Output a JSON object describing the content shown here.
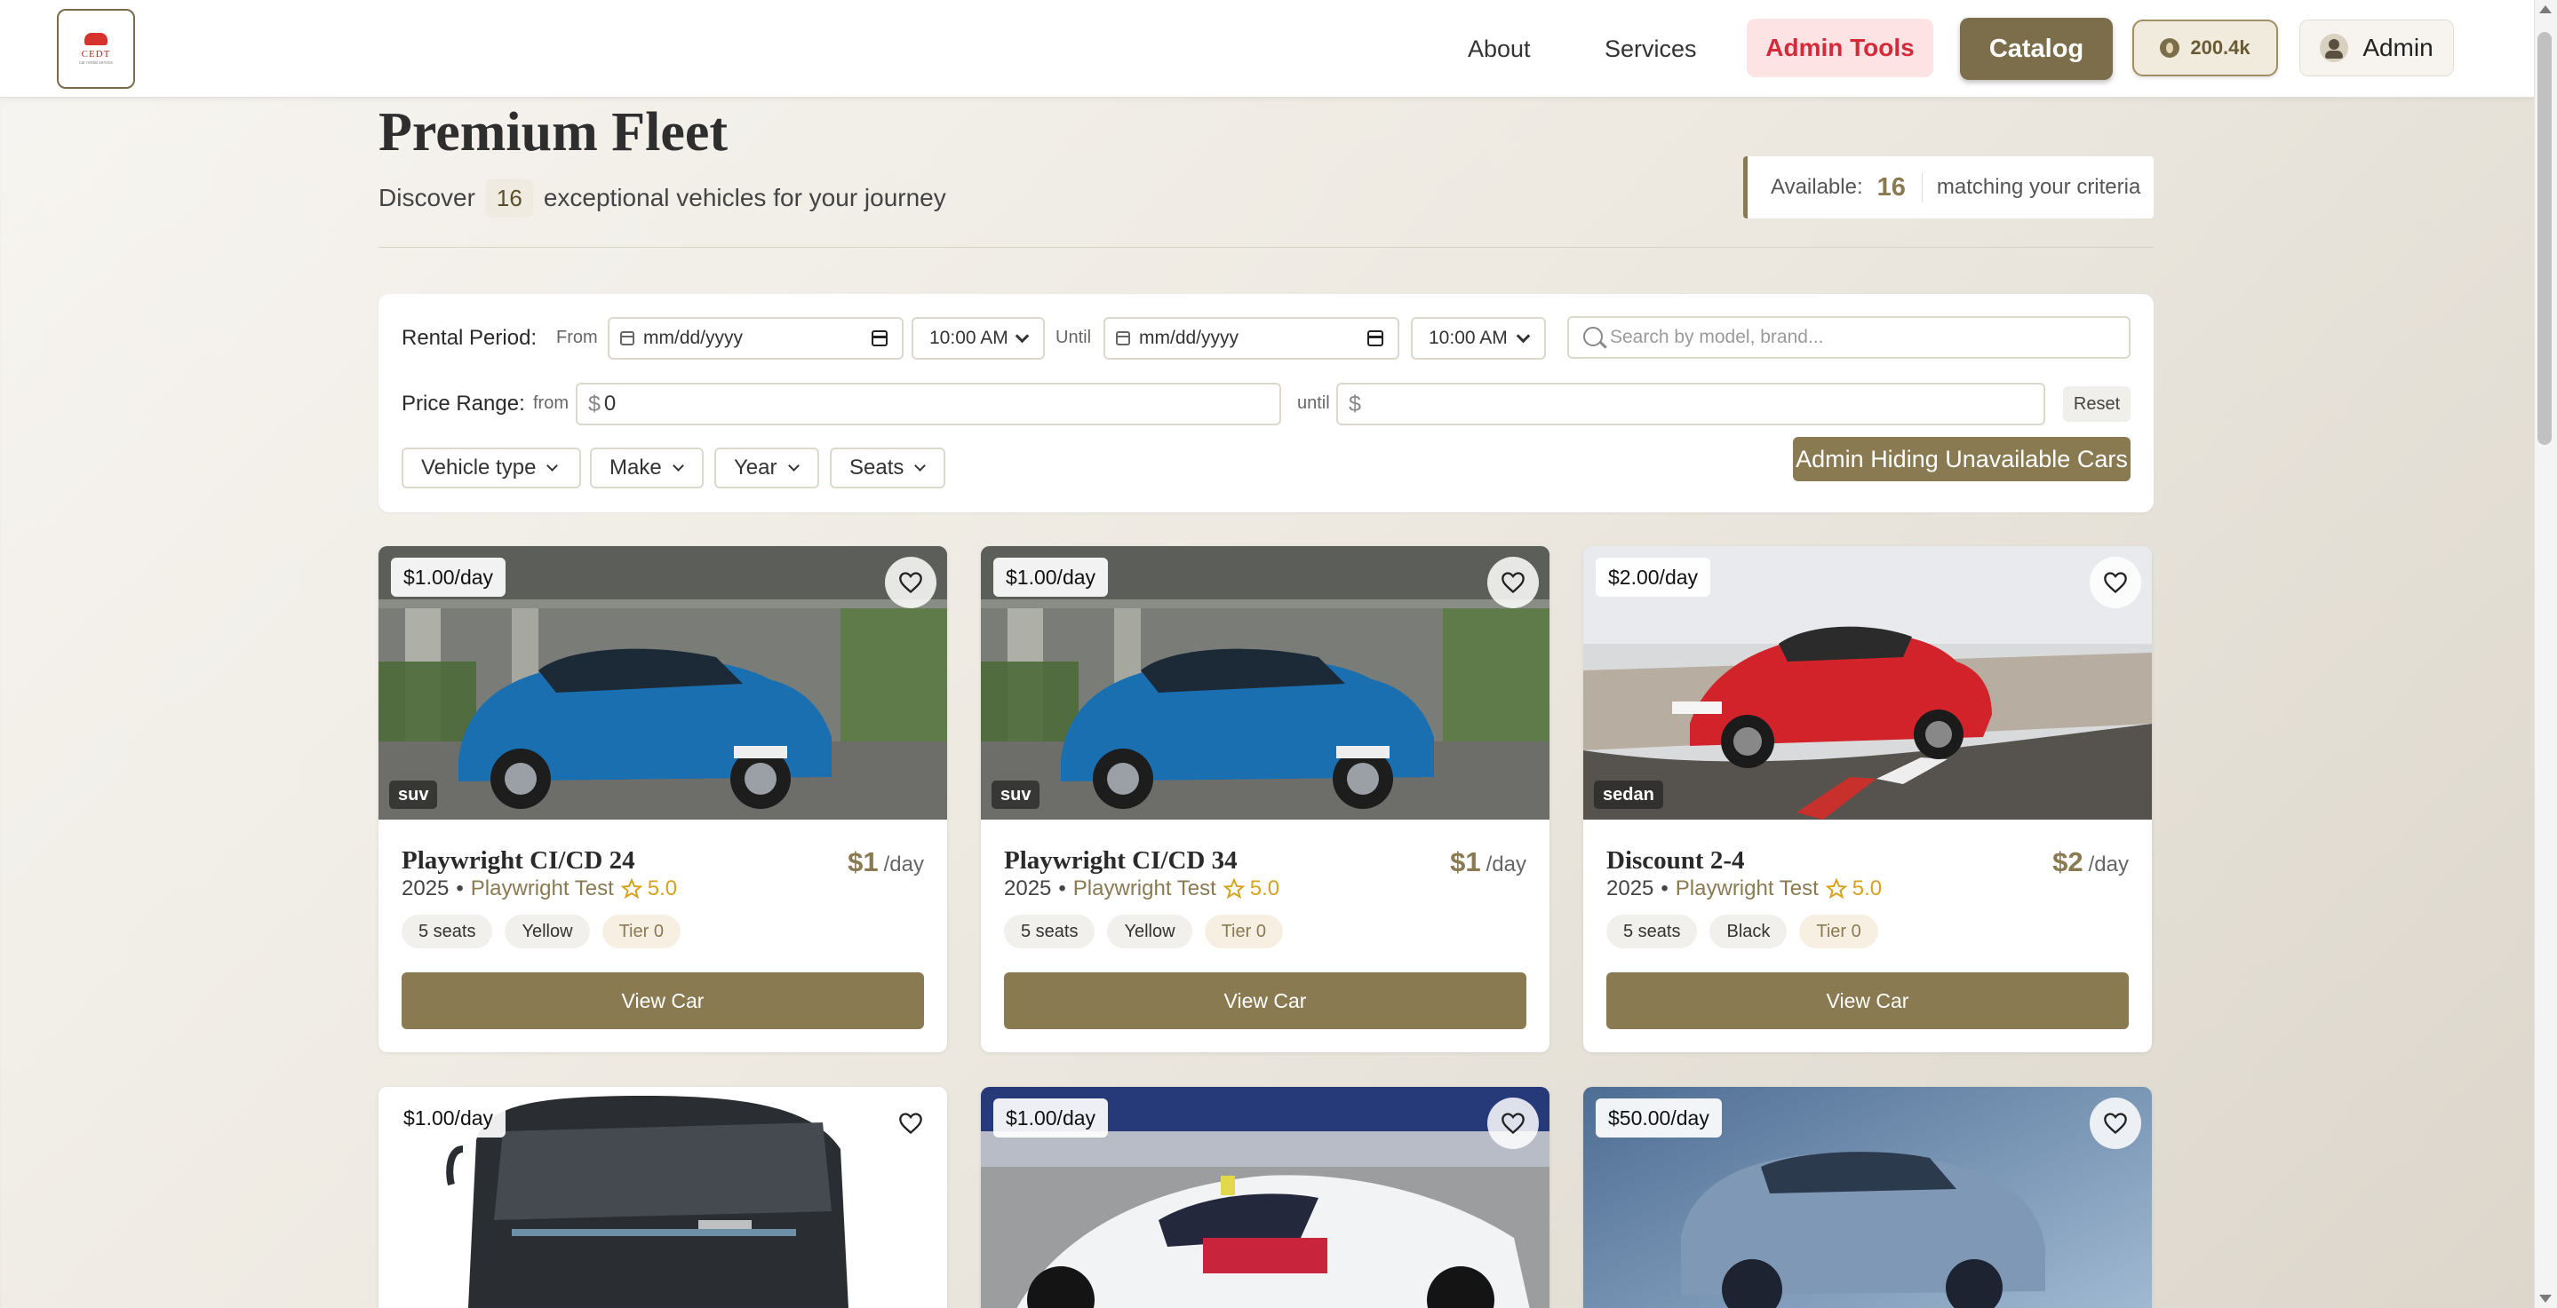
{
  "header": {
    "logo": {
      "text": "CEDT",
      "sub": "car rental service"
    },
    "nav": [
      "About",
      "Services"
    ],
    "admin_tools": "Admin Tools",
    "catalog": "Catalog",
    "balance": "200.4k",
    "user": "Admin"
  },
  "page": {
    "title": "Premium Fleet",
    "subtitle_pre": "Discover",
    "count": "16",
    "subtitle_post": "exceptional vehicles for your journey",
    "available_label": "Available:",
    "available_count": "16",
    "available_suffix": "matching your criteria"
  },
  "filters": {
    "rental_period_label": "Rental Period:",
    "from_label": "From",
    "from_date": "mm/dd/yyyy",
    "from_time": "10:00 AM",
    "until_label": "Until",
    "until_date": "mm/dd/yyyy",
    "until_time": "10:00 AM",
    "search_placeholder": "Search by model, brand...",
    "price_range_label": "Price Range:",
    "price_from_label": "from",
    "price_currency": "$",
    "price_from_value": "0",
    "price_until_label": "until",
    "price_until_value": "",
    "reset": "Reset",
    "dropdowns": [
      "Vehicle type",
      "Make",
      "Year",
      "Seats"
    ],
    "admin_hide": "Admin Hiding Unavailable Cars"
  },
  "cars": [
    {
      "price_tag": "$1.00/day",
      "type": "suv",
      "name": "Playwright CI/CD 24",
      "price": "$1",
      "per": "/day",
      "year": "2025",
      "brand": "Playwright Test",
      "rating": "5.0",
      "seats": "5 seats",
      "color": "Yellow",
      "tier": "Tier 0",
      "cta": "View Car",
      "image": "blue-hatchback"
    },
    {
      "price_tag": "$1.00/day",
      "type": "suv",
      "name": "Playwright CI/CD 34",
      "price": "$1",
      "per": "/day",
      "year": "2025",
      "brand": "Playwright Test",
      "rating": "5.0",
      "seats": "5 seats",
      "color": "Yellow",
      "tier": "Tier 0",
      "cta": "View Car",
      "image": "blue-hatchback"
    },
    {
      "price_tag": "$2.00/day",
      "type": "sedan",
      "name": "Discount 2-4",
      "price": "$2",
      "per": "/day",
      "year": "2025",
      "brand": "Playwright Test",
      "rating": "5.0",
      "seats": "5 seats",
      "color": "Black",
      "tier": "Tier 0",
      "cta": "View Car",
      "image": "red-sports-car"
    },
    {
      "price_tag": "$1.00/day",
      "image": "black-bus"
    },
    {
      "price_tag": "$1.00/day",
      "image": "formula-e-race-car"
    },
    {
      "price_tag": "$50.00/day",
      "image": "blue-compact-suv"
    }
  ],
  "colors": {
    "accent": "#8a7a52",
    "admin": "#d42a3a",
    "star": "#d7a21d"
  }
}
